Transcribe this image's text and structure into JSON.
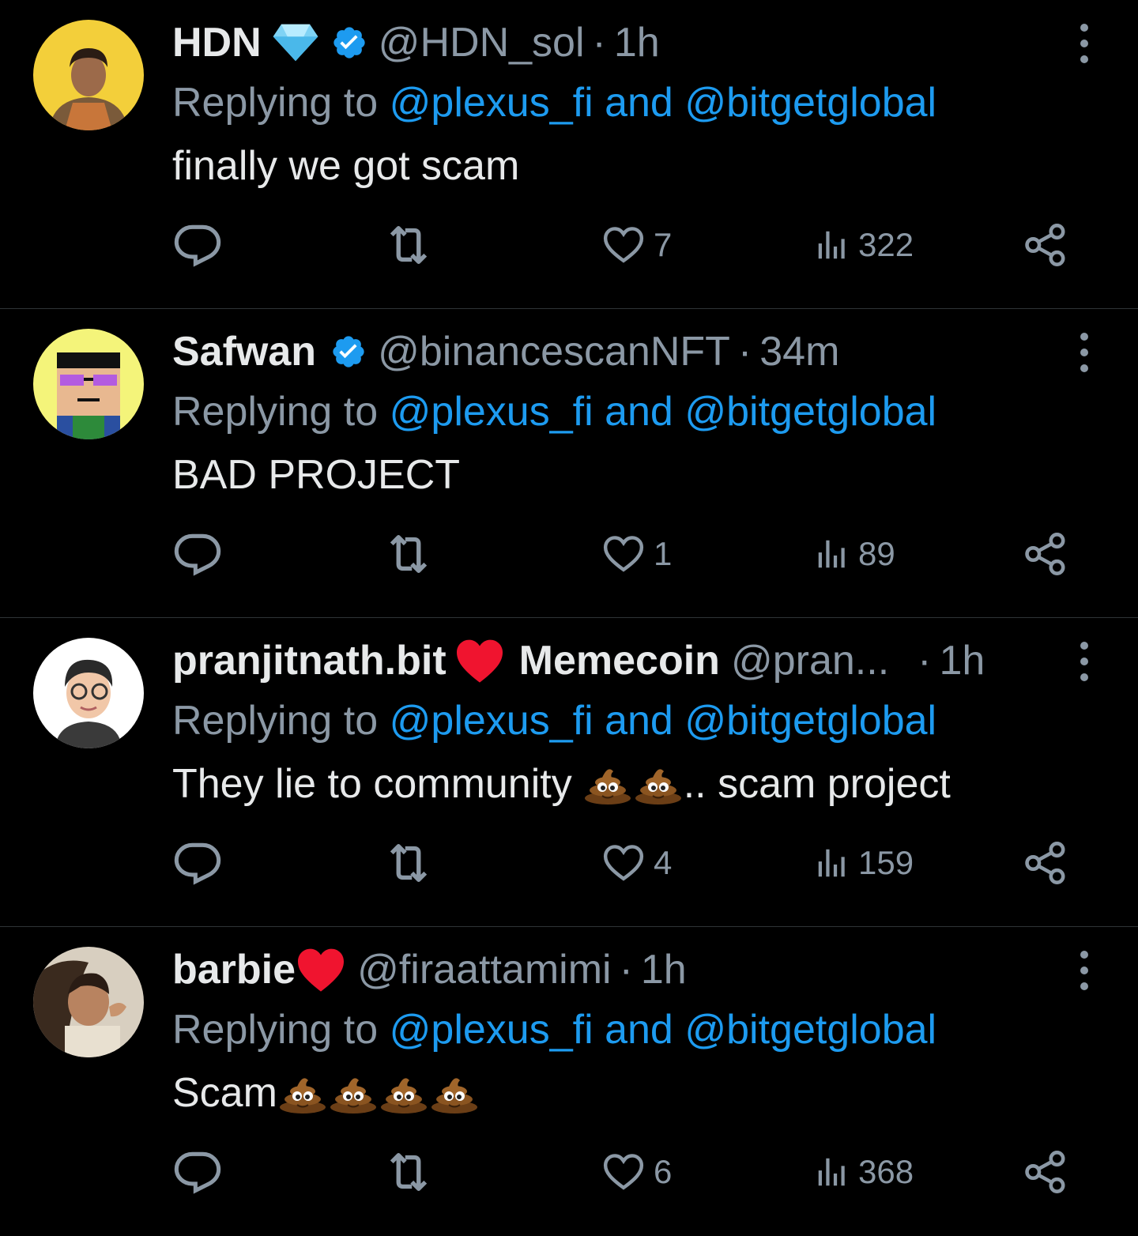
{
  "tweets": [
    {
      "display_name": "HDN",
      "name_emoji": "gem-icon",
      "verified": true,
      "handle": "@HDN_sol",
      "separator": "·",
      "time": "1h",
      "reply_prefix": "Replying to",
      "mention1": "@plexus_fi",
      "and": "and",
      "mention2": "@bitgetglobal",
      "text": "finally we got scam",
      "likes": "7",
      "views": "322"
    },
    {
      "display_name": "Safwan",
      "verified": true,
      "handle": "@binancescanNFT",
      "separator": "·",
      "time": "34m",
      "reply_prefix": "Replying to",
      "mention1": "@plexus_fi",
      "and": "and",
      "mention2": "@bitgetglobal",
      "text": "BAD PROJECT",
      "likes": "1",
      "views": "89"
    },
    {
      "display_name": "pranjitnath.bit",
      "name_emoji": "red-heart-icon",
      "display_name_suffix": "Memecoin",
      "handle": "@pran...",
      "separator": "·",
      "time": "1h",
      "reply_prefix": "Replying to",
      "mention1": "@plexus_fi",
      "and": "and",
      "mention2": "@bitgetglobal",
      "text_before": "They lie to community",
      "text_after": ".. scam project",
      "likes": "4",
      "views": "159"
    },
    {
      "display_name": "barbie",
      "name_emoji": "red-heart-icon",
      "handle": "@firaattamimi",
      "separator": "·",
      "time": "1h",
      "reply_prefix": "Replying to",
      "mention1": "@plexus_fi",
      "and": "and",
      "mention2": "@bitgetglobal",
      "text": "Scam",
      "likes": "6",
      "views": "368"
    }
  ],
  "colors": {
    "background": "#000000",
    "text": "#e7e9ea",
    "muted": "#8b98a5",
    "accent": "#1d9bf0",
    "divider": "#2f3336",
    "heart_emoji": "#f0142f"
  }
}
